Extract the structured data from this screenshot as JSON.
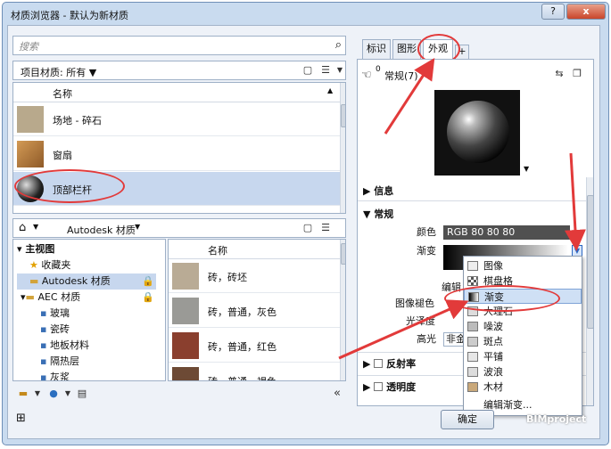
{
  "window": {
    "title": "材质浏览器 - 默认为新材质",
    "help": "?",
    "close": "x"
  },
  "search": {
    "placeholder": "搜索"
  },
  "project": {
    "filter_label": "项目材质: 所有 ▼",
    "col_header": "名称",
    "items": [
      {
        "label": "场地 - 碎石",
        "color": "#b8a98c"
      },
      {
        "label": "窗扇",
        "color": "#b77a3b"
      },
      {
        "label": "顶部栏杆",
        "color": "#2b2b2b"
      }
    ]
  },
  "library": {
    "crumb": "Autodesk 材质",
    "tree": [
      {
        "label": "主视图",
        "level": 0
      },
      {
        "label": "收藏夹",
        "level": 1
      },
      {
        "label": "Autodesk 材质",
        "level": 1
      },
      {
        "label": "AEC 材质",
        "level": 1
      },
      {
        "label": "玻璃",
        "level": 2
      },
      {
        "label": "瓷砖",
        "level": 2
      },
      {
        "label": "地板材料",
        "level": 2
      },
      {
        "label": "隔热层",
        "level": 2
      },
      {
        "label": "灰浆",
        "level": 2
      }
    ],
    "col_header": "名称",
    "items": [
      {
        "label": "砖，砖坯",
        "color": "#b9ab95"
      },
      {
        "label": "砖，普通，灰色",
        "color": "#9a9a96"
      },
      {
        "label": "砖，普通，红色",
        "color": "#8a3f2e"
      },
      {
        "label": "砖，普通，褐色",
        "color": "#6d4a35"
      }
    ]
  },
  "tabs": [
    "标识",
    "图形",
    "外观",
    "+"
  ],
  "appearance": {
    "asset_name": "常规(7)",
    "asset_count": "0",
    "sections": {
      "info": "信息",
      "general": "常规",
      "reflectivity": "反射率",
      "transparency": "透明度"
    },
    "color_label": "颜色",
    "color_value": "RGB 80 80 80",
    "gradient_label": "渐变",
    "edit_label": "编辑",
    "image_fade_label": "图像褪色",
    "gloss_label": "光泽度",
    "highlight_label": "高光",
    "highlight_value": "非金"
  },
  "menu": {
    "items": [
      "图像",
      "棋盘格",
      "渐变",
      "大理石",
      "噪波",
      "斑点",
      "平铺",
      "波浪",
      "木材",
      "编辑渐变..."
    ],
    "selected": "渐变"
  },
  "footer": {
    "ok": "确定",
    "watermark": "BIMproject"
  },
  "accent": "#e23a3a"
}
